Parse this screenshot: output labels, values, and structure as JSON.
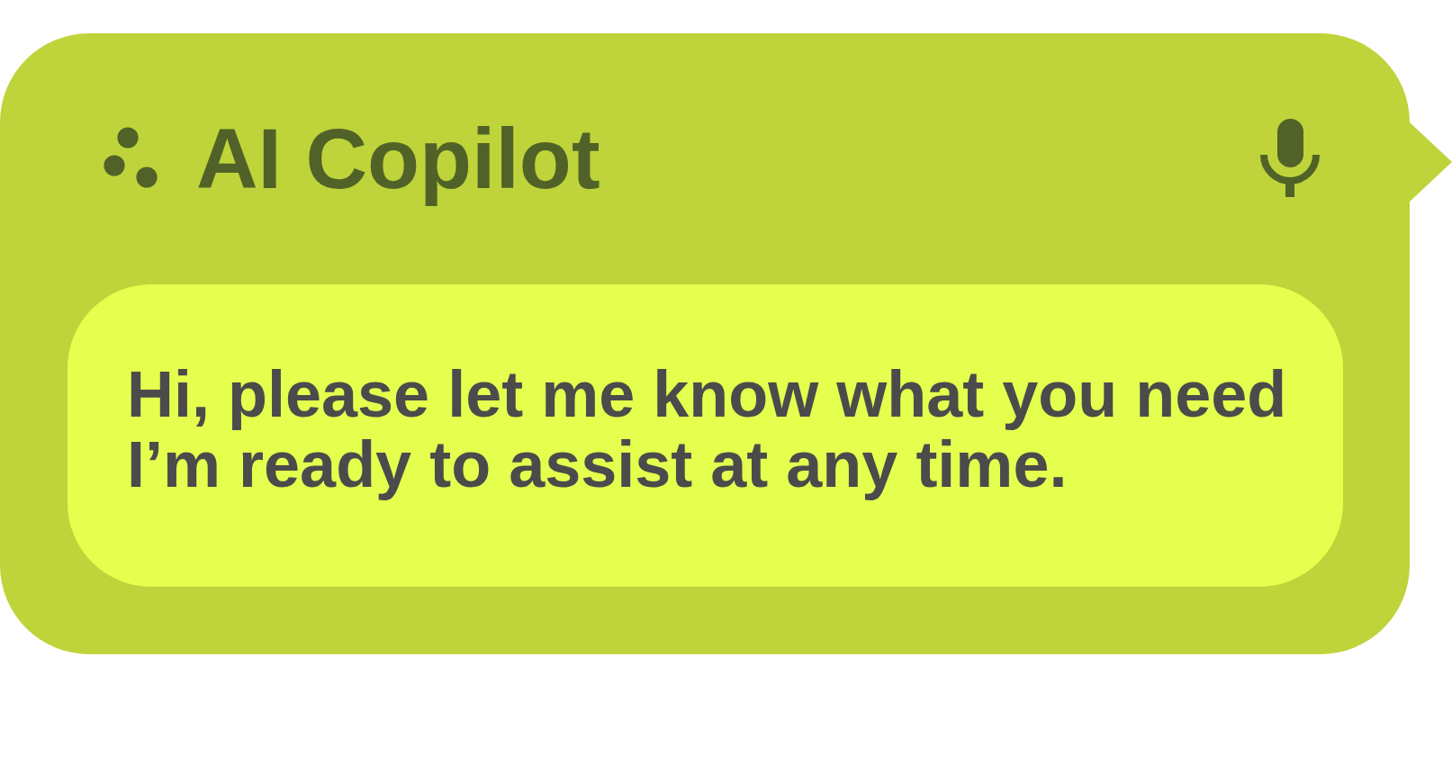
{
  "header": {
    "title": "AI Copilot"
  },
  "message": {
    "text": "Hi, please let me know what you need\nI’m ready to assist at any time."
  }
}
